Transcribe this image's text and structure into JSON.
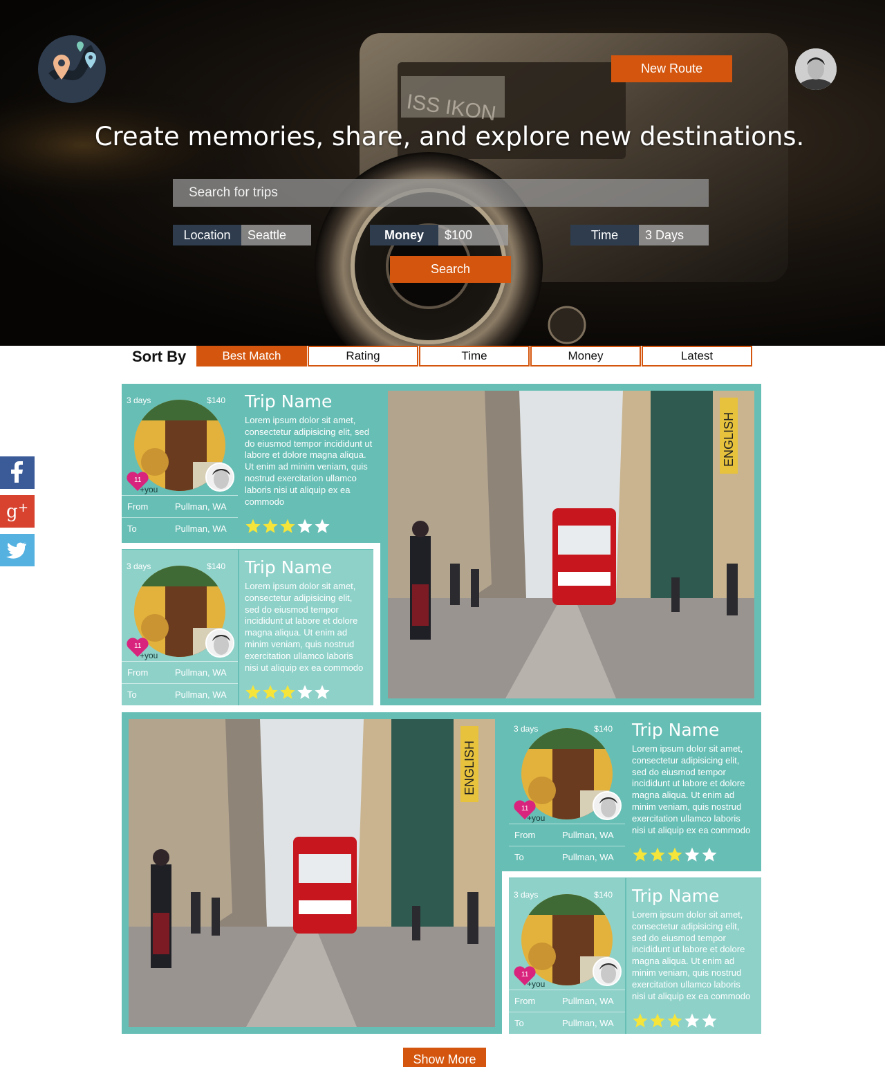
{
  "header": {
    "headline": "Create memories, share, and explore new destinations.",
    "new_route_label": "New Route",
    "search": {
      "placeholder": "Search for trips",
      "value": ""
    },
    "filters": [
      {
        "label": "Location",
        "value": "Seattle"
      },
      {
        "label": "Money",
        "value": "$100"
      },
      {
        "label": "Time",
        "value": "3 Days"
      }
    ],
    "search_button": "Search"
  },
  "sort": {
    "label": "Sort By",
    "options": [
      "Best Match",
      "Rating",
      "Time",
      "Money",
      "Latest"
    ],
    "active": "Best Match"
  },
  "social": [
    "facebook",
    "google-plus",
    "twitter"
  ],
  "trips": [
    {
      "days": "3 days",
      "price": "$140",
      "likes": "11",
      "plus_you": "+you",
      "from_label": "From",
      "from": "Pullman, WA",
      "to_label": "To",
      "to": "Pullman, WA",
      "title": "Trip Name",
      "description": "Lorem ipsum dolor sit amet, consectetur adipisicing elit, sed do eiusmod tempor incididunt ut labore et dolore magna aliqua. Ut enim ad minim veniam, quis nostrud exercitation ullamco laboris nisi ut aliquip ex ea commodo",
      "rating": 3
    },
    {
      "days": "3 days",
      "price": "$140",
      "likes": "11",
      "plus_you": "+you",
      "from_label": "From",
      "from": "Pullman, WA",
      "to_label": "To",
      "to": "Pullman, WA",
      "title": "Trip Name",
      "description": "Lorem ipsum dolor sit amet, consectetur adipisicing elit, sed do eiusmod tempor incididunt ut labore et dolore magna aliqua. Ut enim ad minim veniam, quis nostrud exercitation ullamco laboris nisi ut aliquip ex ea commodo",
      "rating": 3
    },
    {
      "days": "3 days",
      "price": "$140",
      "likes": "11",
      "plus_you": "+you",
      "from_label": "From",
      "from": "Pullman, WA",
      "to_label": "To",
      "to": "Pullman, WA",
      "title": "Trip Name",
      "description": "Lorem ipsum dolor sit amet, consectetur adipisicing elit, sed do eiusmod tempor incididunt ut labore et dolore magna aliqua. Ut enim ad minim veniam, quis nostrud exercitation ullamco laboris nisi ut aliquip ex ea commodo",
      "rating": 3
    },
    {
      "days": "3 days",
      "price": "$140",
      "likes": "11",
      "plus_you": "+you",
      "from_label": "From",
      "from": "Pullman, WA",
      "to_label": "To",
      "to": "Pullman, WA",
      "title": "Trip Name",
      "description": "Lorem ipsum dolor sit amet, consectetur adipisicing elit, sed do eiusmod tempor incididunt ut labore et dolore magna aliqua. Ut enim ad minim veniam, quis nostrud exercitation ullamco laboris nisi ut aliquip ex ea commodo",
      "rating": 3
    }
  ],
  "featured_photo_sign": "ENGLISH",
  "show_more_label": "Show More",
  "colors": {
    "accent": "#d4560e",
    "teal": "#67beb5",
    "teal_light": "#8ed1c9",
    "navy": "#2e3c4e"
  }
}
